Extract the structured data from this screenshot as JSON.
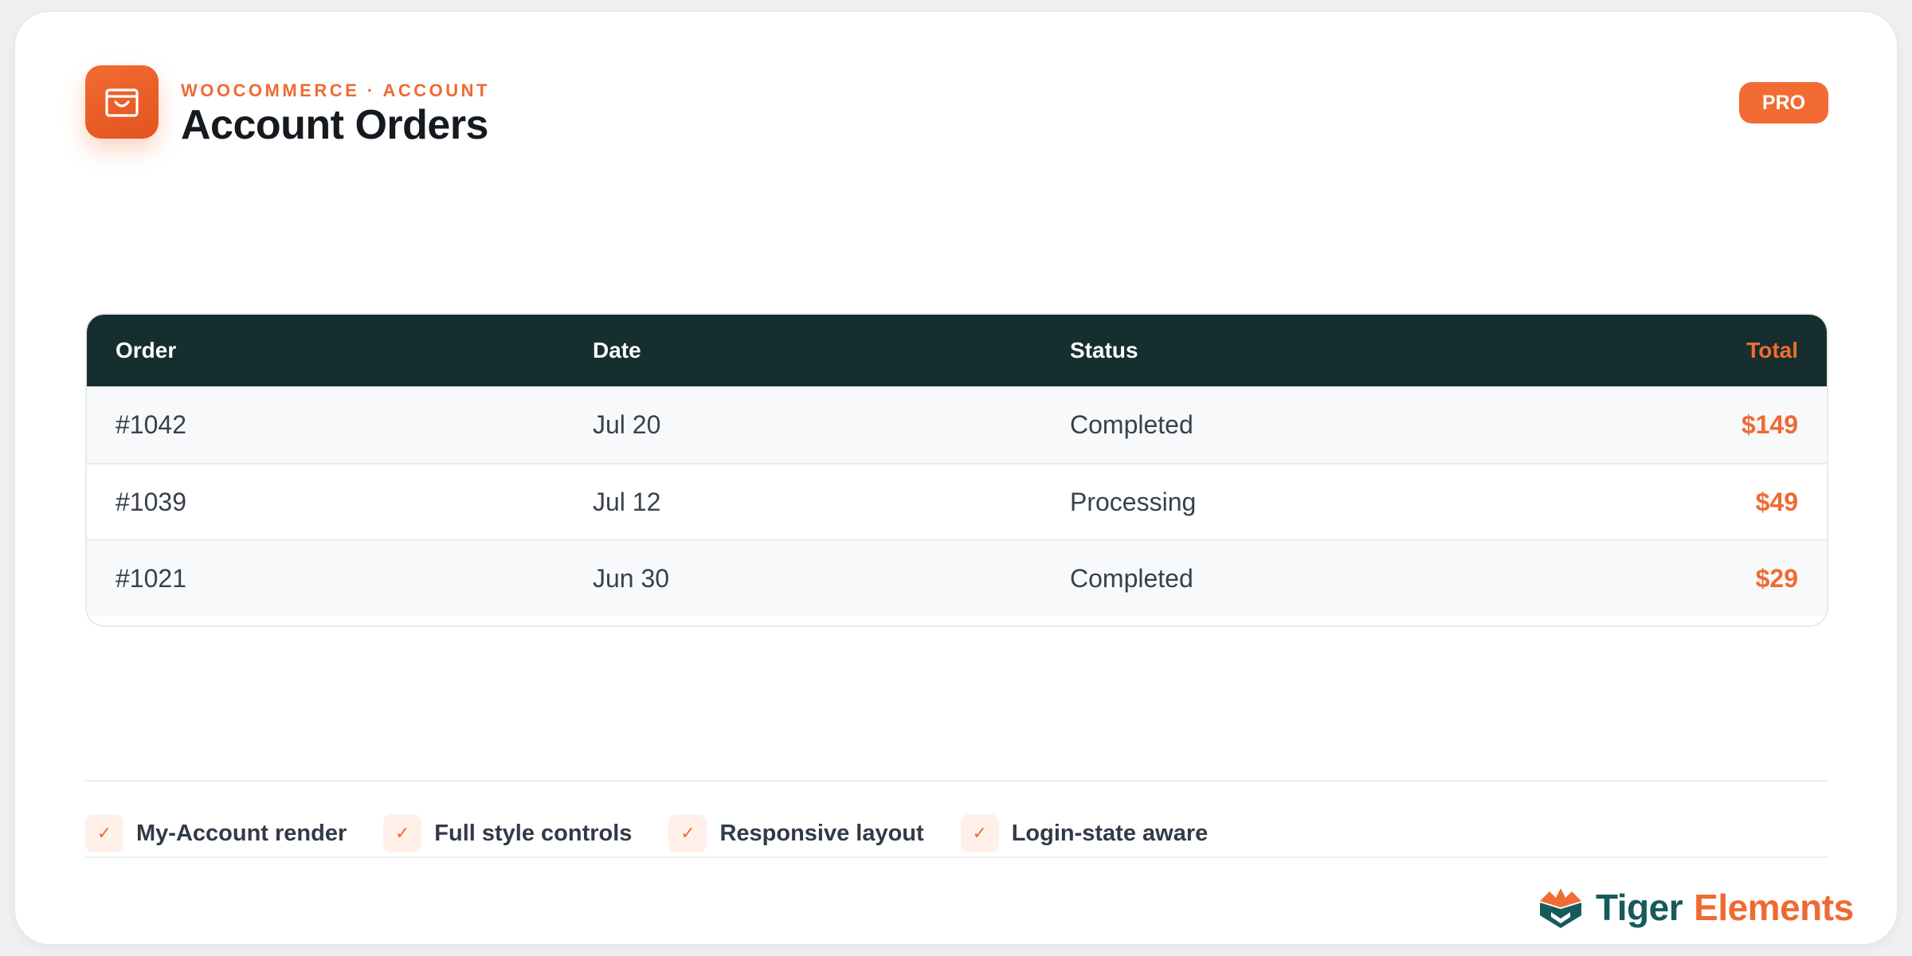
{
  "header": {
    "icon": "shopping-bag-icon",
    "eyebrow": "WOOCOMMERCE · ACCOUNT",
    "title": "Account Orders",
    "badge": "PRO"
  },
  "table": {
    "columns": [
      "Order",
      "Date",
      "Status",
      "Total"
    ],
    "rows": [
      {
        "order": "#1042",
        "date": "Jul 20",
        "status": "Completed",
        "total": "$149"
      },
      {
        "order": "#1039",
        "date": "Jul 12",
        "status": "Processing",
        "total": "$49"
      },
      {
        "order": "#1021",
        "date": "Jun 30",
        "status": "Completed",
        "total": "$29"
      }
    ]
  },
  "features": [
    {
      "icon": "check-icon",
      "label": "My-Account render"
    },
    {
      "icon": "check-icon",
      "label": "Full style controls"
    },
    {
      "icon": "check-icon",
      "label": "Responsive layout"
    },
    {
      "icon": "check-icon",
      "label": "Login-state aware"
    }
  ],
  "brand": {
    "logo": "tiger-elements-logo",
    "name_part1": "Tiger",
    "name_part2": "Elements"
  },
  "colors": {
    "accent": "#f26b33",
    "header_bg": "#162e2e",
    "brand_teal": "#175a5c",
    "text_dark": "#141a1f"
  }
}
